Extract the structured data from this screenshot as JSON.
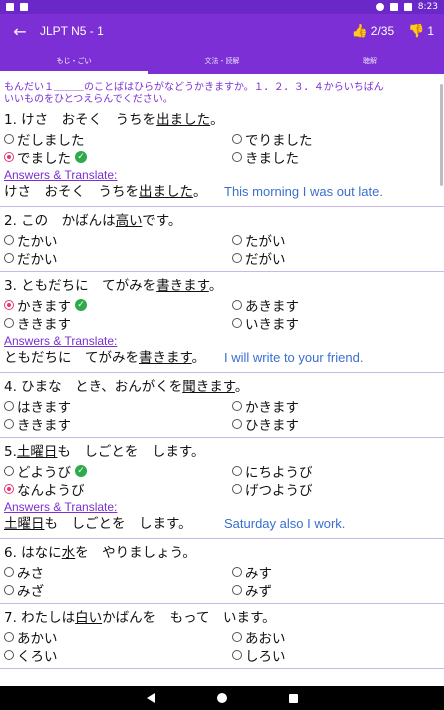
{
  "status_bar": {
    "time": "8:23"
  },
  "app_bar": {
    "back_icon": "arrow-left-icon",
    "title": "JLPT N5 - 1",
    "likes": "2/35",
    "dislikes": "1"
  },
  "tabs": [
    {
      "label": "もじ・ごい",
      "active": true
    },
    {
      "label": "文法・読解",
      "active": false
    },
    {
      "label": "聴解",
      "active": false
    }
  ],
  "instruction": {
    "line1": "もんだい１＿＿＿のことばはひらがなどうかきますか。１．２．３．４からいちばん",
    "line2": "いいものをひとつえらんでください。"
  },
  "answers_label": "Answers & Translate:",
  "questions": [
    {
      "pre": "1. けさ　おそく　うちを",
      "u": "出ました",
      "post": "。",
      "options": [
        "だしました",
        "でりました",
        "でました",
        "きました"
      ],
      "selected": 2,
      "answer": {
        "pre": "けさ　おそく　うちを",
        "u": "出ました",
        "post": "。",
        "translation": "This morning I was out late."
      }
    },
    {
      "pre": "2. この　かばんは",
      "u": "高い",
      "post": "です。",
      "options": [
        "たかい",
        "たがい",
        "だかい",
        "だがい"
      ]
    },
    {
      "pre": "3. ともだちに　てがみを",
      "u": "書きます",
      "post": "。",
      "options": [
        "かきます",
        "あきます",
        "ききます",
        "いきます"
      ],
      "selected": 0,
      "answer": {
        "pre": "ともだちに　てがみを",
        "u": "書きます",
        "post": "。",
        "translation": "I will write to your friend."
      }
    },
    {
      "pre": "4. ひまな　とき、おんがくを",
      "u": "聞きます",
      "post": "。",
      "options": [
        "はきます",
        "かきます",
        "ききます",
        "ひきます"
      ]
    },
    {
      "pre": "5.",
      "u": "土曜日",
      "post": "も　しごとを　します。",
      "options": [
        "どようび",
        "にちようび",
        "なんようび",
        "げつようび"
      ],
      "selected": 2,
      "correct": 0,
      "answer": {
        "pre": "",
        "u": "土曜日",
        "post": "も　しごとを　します。",
        "translation": "Saturday also I work."
      }
    },
    {
      "pre": "6. はなに",
      "u": "水",
      "post": "を　やりましょう。",
      "options": [
        "みさ",
        "みす",
        "みざ",
        "みず"
      ]
    },
    {
      "pre": "7. わたしは",
      "u": "白い",
      "post": "かばんを　もって　います。",
      "options": [
        "あかい",
        "あおい",
        "くろい",
        "しろい"
      ]
    }
  ]
}
